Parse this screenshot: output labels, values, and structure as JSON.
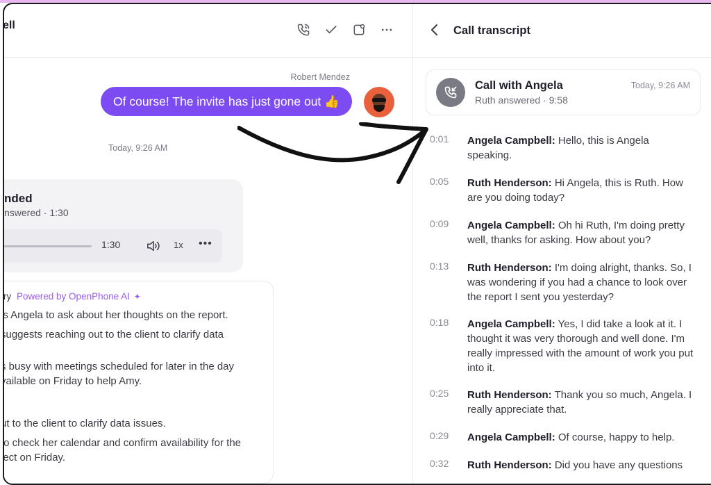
{
  "conversation": {
    "contact_name": "ell",
    "header_icons": [
      "phone-icon",
      "check-icon",
      "assign-icon",
      "more-icon"
    ]
  },
  "message": {
    "sender": "Robert Mendez",
    "text": "Of course! The invite has just gone out 👍"
  },
  "timeline": {
    "timestamp": "Today, 9:26 AM"
  },
  "call_card": {
    "title": "nded",
    "subtitle": "nswered · 1:30",
    "duration": "1:30",
    "speed": "1x"
  },
  "summary": {
    "title_fragment": "ry",
    "powered_by": "Powered by OpenPhone AI",
    "lines": [
      "ls Angela to ask about her thoughts on the report.",
      "suggests reaching out to the client to clarify data",
      "s busy with meetings scheduled for later in the day",
      "vailable on Friday to help Amy.",
      "ut to the client to clarify data issues.",
      "to check her calendar and confirm availability for the",
      "ject on Friday."
    ]
  },
  "transcript_panel": {
    "title": "Call transcript",
    "call_title": "Call with Angela",
    "call_sub": "Ruth answered · 9:58",
    "call_time": "Today, 9:26 AM",
    "entries": [
      {
        "time": "0:01",
        "speaker": "Angela Campbell:",
        "text": "Hello, this is Angela speaking."
      },
      {
        "time": "0:05",
        "speaker": "Ruth Henderson:",
        "text": "Hi Angela, this is Ruth. How are you doing today?"
      },
      {
        "time": "0:09",
        "speaker": "Angela Campbell:",
        "text": "Oh hi Ruth, I'm doing pretty well, thanks for asking. How about you?"
      },
      {
        "time": "0:13",
        "speaker": "Ruth Henderson:",
        "text": "I'm doing alright, thanks. So, I was wondering if you had a chance to look over the report I sent you yesterday?"
      },
      {
        "time": "0:18",
        "speaker": "Angela Campbell:",
        "text": "Yes, I did take a look at it. I thought it was very thorough and well done. I'm really impressed with the amount of work you put into it."
      },
      {
        "time": "0:25",
        "speaker": "Ruth Henderson:",
        "text": "Thank you so much, Angela. I really appreciate that."
      },
      {
        "time": "0:29",
        "speaker": "Angela Campbell:",
        "text": "Of course, happy to help."
      },
      {
        "time": "0:32",
        "speaker": "Ruth Henderson:",
        "text": "Did you have any questions"
      }
    ]
  },
  "colors": {
    "accent": "#7c4cf2",
    "ai_label": "#9a5cf0",
    "frame": "#1b1b1b"
  }
}
